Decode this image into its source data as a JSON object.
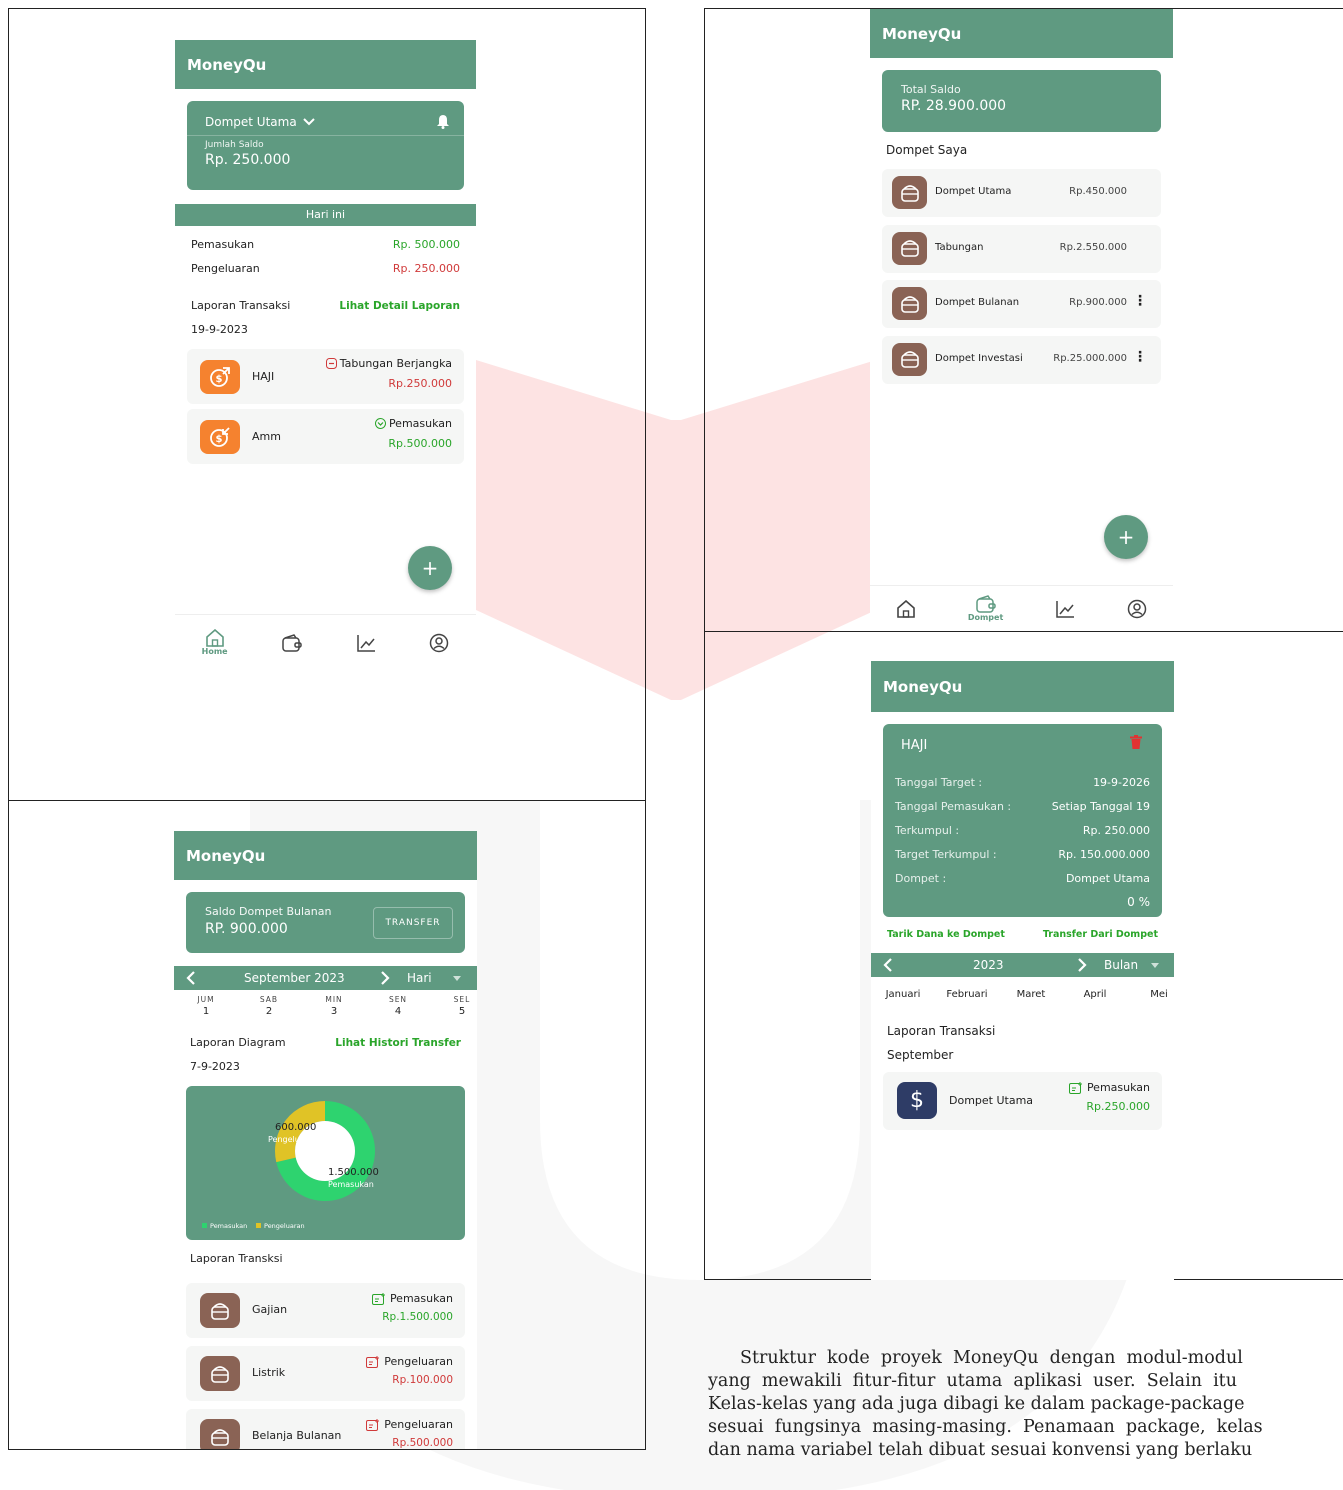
{
  "app_name": "MoneyQu",
  "colors": {
    "primary": "#5f9a81",
    "green_text": "#2aa52a",
    "red_text": "#d03a3a",
    "orange": "#f5822f",
    "brown": "#8a6355",
    "navy": "#2e3c66"
  },
  "screen_home": {
    "wallet_name": "Dompet Utama",
    "balance_label": "Jumlah Saldo",
    "balance_value": "Rp. 250.000",
    "today_label": "Hari ini",
    "income_label": "Pemasukan",
    "income_value": "Rp. 500.000",
    "expense_label": "Pengeluaran",
    "expense_value": "Rp. 250.000",
    "report_label": "Laporan Transaksi",
    "report_link": "Lihat Detail Laporan",
    "date": "19-9-2023",
    "transactions": [
      {
        "name": "HAJI",
        "type": "Tabungan Berjangka",
        "amount": "Rp.250.000",
        "icon": "coin-up-icon"
      },
      {
        "name": "Amm",
        "type": "Pemasukan",
        "amount": "Rp.500.000",
        "icon": "coin-down-icon"
      }
    ],
    "fab": "+",
    "nav_home_label": "Home"
  },
  "screen_wallets": {
    "total_label": "Total Saldo",
    "total_value": "RP. 28.900.000",
    "section_label": "Dompet Saya",
    "wallets": [
      {
        "name": "Dompet Utama",
        "amount": "Rp.450.000",
        "menu": false
      },
      {
        "name": "Tabungan",
        "amount": "Rp.2.550.000",
        "menu": false
      },
      {
        "name": "Dompet Bulanan",
        "amount": "Rp.900.000",
        "menu": true
      },
      {
        "name": "Dompet Investasi",
        "amount": "Rp.25.000.000",
        "menu": true
      }
    ],
    "fab": "+",
    "nav_wallet_label": "Dompet"
  },
  "screen_monthly": {
    "balance_label": "Saldo Dompet Bulanan",
    "balance_value": "RP. 900.000",
    "transfer_button": "TRANSFER",
    "month": "September 2023",
    "period": "Hari",
    "days": [
      {
        "day": "JUM",
        "date": "1"
      },
      {
        "day": "SAB",
        "date": "2"
      },
      {
        "day": "MIN",
        "date": "3"
      },
      {
        "day": "SEN",
        "date": "4"
      },
      {
        "day": "SEL",
        "date": "5"
      }
    ],
    "diagram_label": "Laporan Diagram",
    "history_link": "Lihat Histori Transfer",
    "date": "7-9-2023",
    "report_label": "Laporan Transksi",
    "transactions": [
      {
        "name": "Gajian",
        "type": "Pemasukan",
        "amount": "Rp.1.500.000",
        "kind": "in"
      },
      {
        "name": "Listrik",
        "type": "Pengeluaran",
        "amount": "Rp.100.000",
        "kind": "out"
      },
      {
        "name": "Belanja Bulanan",
        "type": "Pengeluaran",
        "amount": "Rp.500.000",
        "kind": "out"
      }
    ]
  },
  "chart_data": {
    "type": "pie",
    "categories": [
      "Pemasukan",
      "Pengeluaran"
    ],
    "values": [
      1500000,
      600000
    ],
    "value_labels": [
      "1.500.000",
      "600.000"
    ],
    "slice_labels": [
      "Pemasukan",
      "Pengelu"
    ],
    "colors": [
      "#2ed36f",
      "#e0c326"
    ],
    "legend": [
      "Pemasukan",
      "Pengeluaran"
    ],
    "legend_position": "bottom-left"
  },
  "screen_goal": {
    "title": "HAJI",
    "fields": [
      {
        "label": "Tanggal Target :",
        "value": "19-9-2026"
      },
      {
        "label": "Tanggal Pemasukan :",
        "value": "Setiap Tanggal  19"
      },
      {
        "label": "Terkumpul :",
        "value": "Rp.  250.000"
      },
      {
        "label": "Target Terkumpul :",
        "value": "Rp.  150.000.000"
      },
      {
        "label": "Dompet :",
        "value": "Dompet Utama"
      }
    ],
    "percent": "0 %",
    "withdraw_link": "Tarik Dana ke Dompet",
    "transfer_link": "Transfer Dari Dompet",
    "year": "2023",
    "period": "Bulan",
    "months": [
      "Januari",
      "Februari",
      "Maret",
      "April",
      "Mei"
    ],
    "report_label": "Laporan Transaksi",
    "month_label": "September",
    "transaction": {
      "name": "Dompet Utama",
      "type": "Pemasukan",
      "amount": "Rp.250.000"
    }
  },
  "paragraph_lines": [
    "Struktur  kode  proyek  MoneyQu  dengan  modul-modul",
    "yang  mewakili  fitur-fitur  utama  aplikasi  user.  Selain  itu",
    "Kelas-kelas yang ada juga dibagi ke dalam package-package",
    "sesuai  fungsinya  masing-masing.  Penamaan  package,  kelas",
    "dan nama variabel telah dibuat sesuai konvensi yang berlaku"
  ]
}
